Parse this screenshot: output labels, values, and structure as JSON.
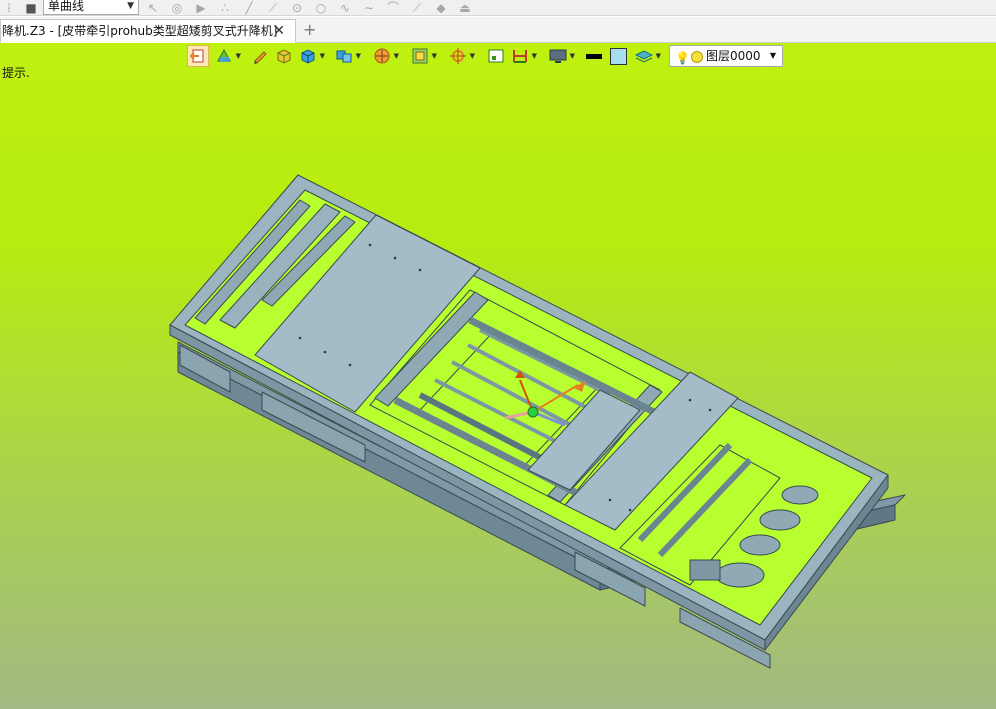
{
  "top_toolbar": {
    "curve_type_select": "单曲线"
  },
  "tabs": [
    {
      "label": "降机.Z3 - [皮带牵引prohub类型超矮剪叉式升降机]",
      "close": "✕"
    }
  ],
  "new_tab": "+",
  "viewport": {
    "hint": "提示.",
    "background_top": "#bff010",
    "background_bottom": "#a3b882"
  },
  "view_toolbar": {
    "icons": [
      "exit-sketch-icon",
      "render-mode-icon",
      "pencil-icon",
      "solid-box-icon",
      "shaded-cube-icon",
      "multi-solid-icon",
      "section-icon",
      "frame-icon",
      "target-icon",
      "fit-icon",
      "dimension-icon",
      "monitor-icon",
      "line-color-swatch",
      "fill-color-swatch",
      "layer-stack-icon"
    ],
    "layer_label": "图层0000"
  }
}
